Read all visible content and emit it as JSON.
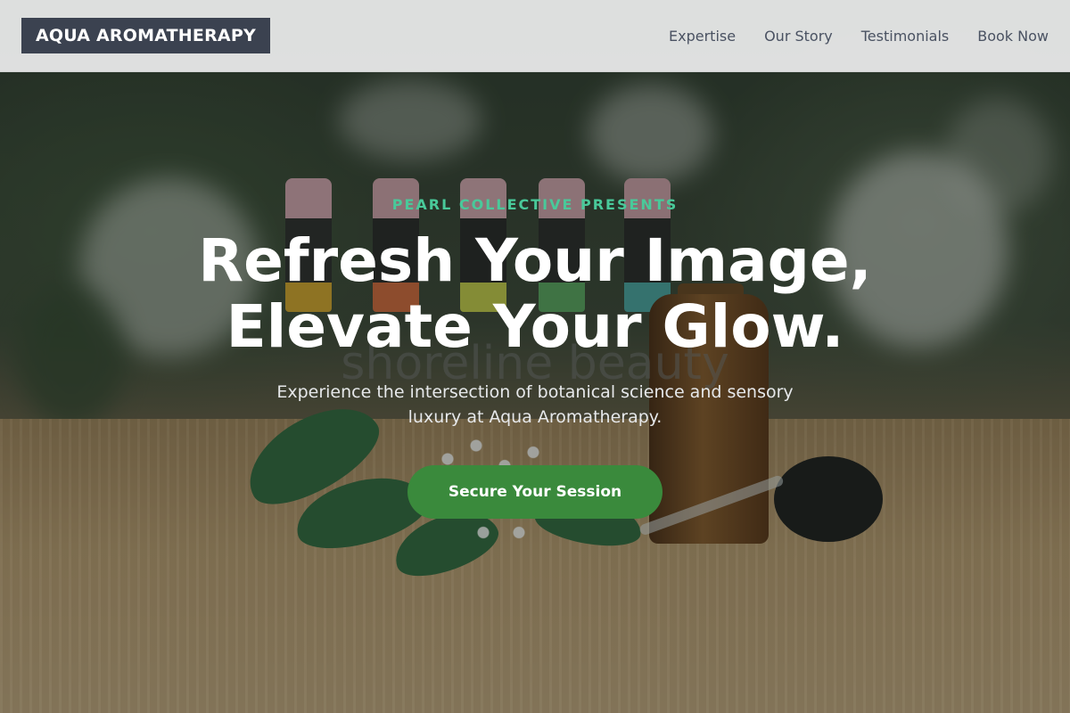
{
  "header": {
    "brand": "AQUA AROMATHERAPY",
    "nav": [
      {
        "label": "Expertise"
      },
      {
        "label": "Our Story"
      },
      {
        "label": "Testimonials"
      },
      {
        "label": "Book Now"
      }
    ]
  },
  "hero": {
    "eyebrow": "PEARL COLLECTIVE PRESENTS",
    "headline_line1": "Refresh Your Image,",
    "headline_line2": "Elevate Your Glow.",
    "subtitle": "Experience the intersection of botanical science and sensory luxury at Aqua Aromatherapy.",
    "cta_label": "Secure Your Session",
    "background_print": "shoreline beauty"
  },
  "colors": {
    "brand_bg": "#3b4250",
    "accent_green": "#3a8a3c",
    "eyebrow_green": "#49c99a",
    "nav_text": "#4a5262",
    "header_bg": "#e8e9e9"
  }
}
